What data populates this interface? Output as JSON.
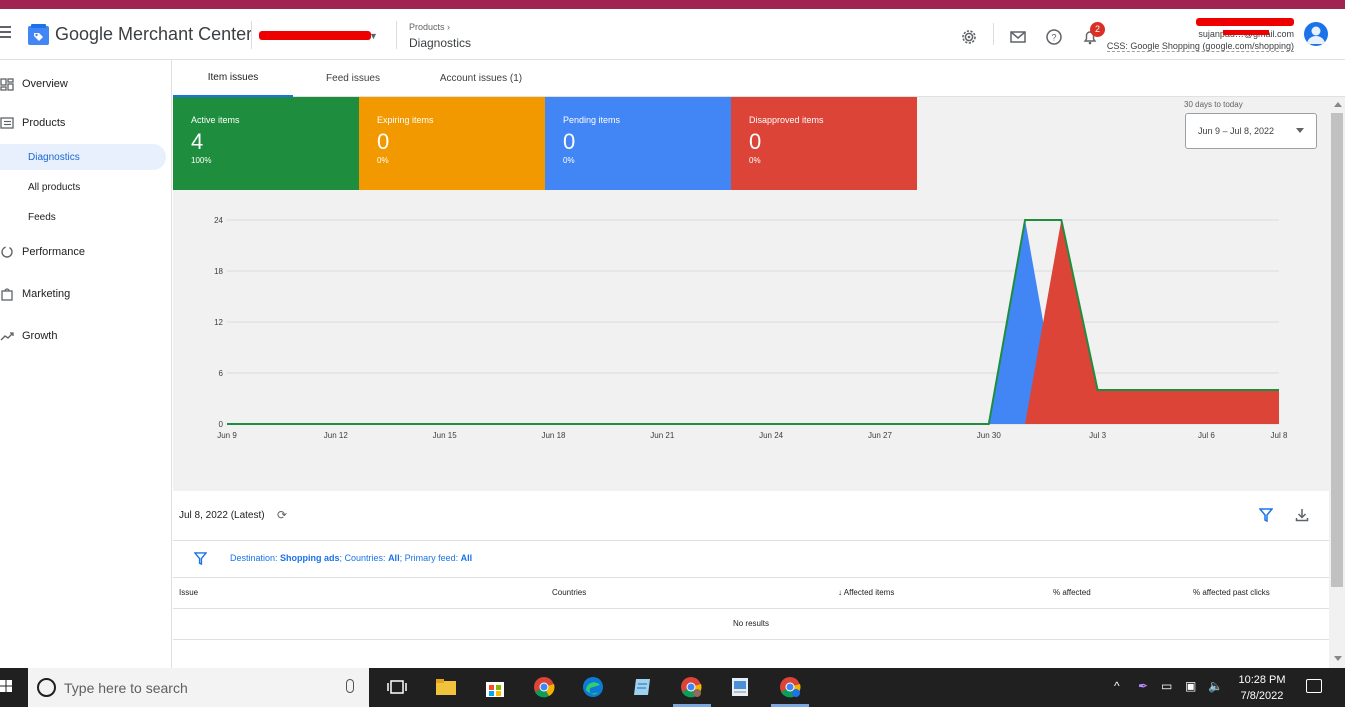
{
  "app": {
    "title": "Google Merchant Center",
    "breadcrumb_parent": "Products",
    "breadcrumb_current": "Diagnostics",
    "notifications_count": "2",
    "account_email": "sujanpau…@gmail.com",
    "account_css": "CSS: Google Shopping (google.com/shopping)"
  },
  "sidebar": {
    "items": [
      {
        "label": "Overview",
        "icon": "dashboard-icon"
      },
      {
        "label": "Products",
        "icon": "list-icon"
      },
      {
        "label": "Diagnostics",
        "sub": true,
        "active": true
      },
      {
        "label": "All products",
        "sub": true
      },
      {
        "label": "Feeds",
        "sub": true
      },
      {
        "label": "Performance",
        "icon": "performance-icon"
      },
      {
        "label": "Marketing",
        "icon": "shopping-bag-icon"
      },
      {
        "label": "Growth",
        "icon": "trending-up-icon"
      }
    ]
  },
  "tabs": [
    {
      "label": "Item issues",
      "active": true
    },
    {
      "label": "Feed issues"
    },
    {
      "label": "Account issues (1)"
    }
  ],
  "cards": [
    {
      "label": "Active items",
      "value": "4",
      "pct": "100%",
      "color": "#1e8e3e"
    },
    {
      "label": "Expiring items",
      "value": "0",
      "pct": "0%",
      "color": "#f29900"
    },
    {
      "label": "Pending items",
      "value": "0",
      "pct": "0%",
      "color": "#4285f4"
    },
    {
      "label": "Disapproved items",
      "value": "0",
      "pct": "0%",
      "color": "#db4437"
    }
  ],
  "date_filter": {
    "caption": "30 days to today",
    "range": "Jun 9 – Jul 8, 2022"
  },
  "chart_data": {
    "type": "area",
    "x": [
      "Jun 9",
      "Jun 10",
      "Jun 11",
      "Jun 12",
      "Jun 13",
      "Jun 14",
      "Jun 15",
      "Jun 16",
      "Jun 17",
      "Jun 18",
      "Jun 19",
      "Jun 20",
      "Jun 21",
      "Jun 22",
      "Jun 23",
      "Jun 24",
      "Jun 25",
      "Jun 26",
      "Jun 27",
      "Jun 28",
      "Jun 29",
      "Jun 30",
      "Jul 1",
      "Jul 2",
      "Jul 3",
      "Jul 4",
      "Jul 5",
      "Jul 6",
      "Jul 7",
      "Jul 8"
    ],
    "x_tick_labels": [
      "Jun 9",
      "Jun 12",
      "Jun 15",
      "Jun 18",
      "Jun 21",
      "Jun 24",
      "Jun 27",
      "Jun 30",
      "Jul 3",
      "Jul 6",
      "Jul 8"
    ],
    "series": [
      {
        "color": "#4285f4",
        "values": [
          0,
          0,
          0,
          0,
          0,
          0,
          0,
          0,
          0,
          0,
          0,
          0,
          0,
          0,
          0,
          0,
          0,
          0,
          0,
          0,
          0,
          0,
          24,
          0,
          0,
          0,
          0,
          0,
          0,
          0
        ]
      },
      {
        "color": "#db4437",
        "values": [
          0,
          0,
          0,
          0,
          0,
          0,
          0,
          0,
          0,
          0,
          0,
          0,
          0,
          0,
          0,
          0,
          0,
          0,
          0,
          0,
          0,
          0,
          0,
          24,
          4,
          4,
          4,
          4,
          4,
          4
        ]
      },
      {
        "color": "#1e8e3e",
        "values": [
          0,
          0,
          0,
          0,
          0,
          0,
          0,
          0,
          0,
          0,
          0,
          0,
          0,
          0,
          0,
          0,
          0,
          0,
          0,
          0,
          0,
          0,
          24,
          24,
          4,
          4,
          4,
          4,
          4,
          4
        ]
      }
    ],
    "y_ticks": [
      0,
      6,
      12,
      18,
      24
    ],
    "ylim": [
      0,
      24
    ],
    "grid": true
  },
  "issues_section": {
    "date": "Jul 8, 2022 (Latest)",
    "filter_prefix": "Destination: ",
    "filter_dest": "Shopping ads",
    "filter_countries_label": "; Countries: ",
    "filter_countries": "All",
    "filter_feed_label": "; Primary feed: ",
    "filter_feed": "All",
    "columns": [
      "Issue",
      "Countries",
      "Affected items",
      "% affected",
      "% affected past clicks"
    ],
    "empty_text": "No results"
  },
  "taskbar": {
    "search_placeholder": "Type here to search",
    "time": "10:28 PM",
    "date": "7/8/2022"
  }
}
